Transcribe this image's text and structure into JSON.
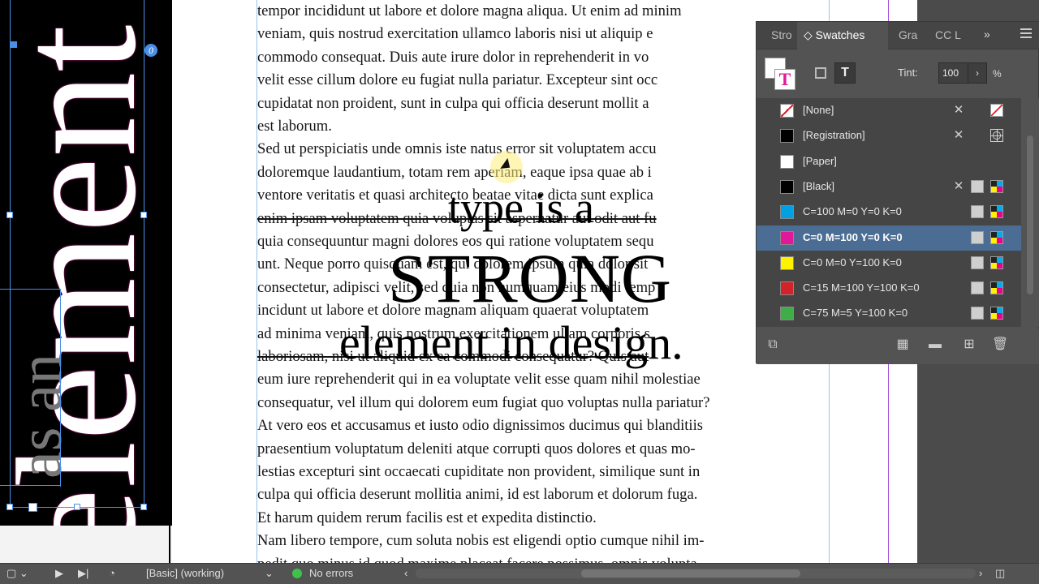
{
  "document": {
    "vertical_big_text": "element",
    "vertical_small_text": "as an",
    "body_lines": [
      "tempor incididunt ut labore et dolore magna aliqua. Ut enim ad minim",
      "veniam, quis nostrud exercitation ullamco laboris nisi ut aliquip e",
      "commodo consequat. Duis aute irure dolor in reprehenderit in vo",
      "velit esse cillum dolore eu fugiat nulla pariatur. Excepteur sint occ",
      "cupidatat non proident, sunt in culpa qui officia deserunt mollit a",
      "est laborum.",
      "Sed ut perspiciatis unde omnis iste natus error sit voluptatem accu",
      "doloremque laudantium, totam rem aperiam, eaque ipsa quae ab i",
      "ventore veritatis et quasi architecto beatae vitae dicta sunt explica",
      "enim ipsam voluptatem quia voluptas sit aspernatur aut odit aut fu",
      "quia consequuntur magni dolores eos qui ratione voluptatem sequ",
      "unt. Neque porro quisquam est, qui dolorem ipsum quia dolor sit",
      "consectetur, adipisci velit, sed quia non numquam eius modi temp",
      "incidunt ut labore et dolore magnam aliquam quaerat voluptatem",
      "ad minima veniam, quis nostrum exercitationem ullam corporis s",
      "laboriosam, nisi ut aliquid ex ea commodi consequatur? Quis aut",
      "eum iure reprehenderit qui in ea voluptate velit esse quam nihil molestiae",
      "consequatur, vel illum qui dolorem eum fugiat quo voluptas nulla pariatur?",
      "At vero eos et accusamus et iusto odio dignissimos ducimus qui blanditiis",
      "praesentium voluptatum deleniti atque corrupti quos dolores et quas mo-",
      "lestias excepturi sint occaecati cupiditate non provident, similique sunt in",
      "culpa qui officia deserunt mollitia animi, id est laborum et dolorum fuga.",
      "Et harum quidem rerum facilis est et expedita distinctio.",
      "Nam libero tempore, cum soluta nobis est eligendi optio cumque nihil im-",
      "pedit quo minus id quod maxime placeat facere possimus, omnis volupta"
    ],
    "display_line_1": "type is a",
    "display_line_2": "STRONG",
    "display_line_3": "element in design."
  },
  "swatches_panel": {
    "tabs": [
      "Stro",
      "Swatches",
      "Gra",
      "CC L"
    ],
    "expand_label": "»",
    "fill_glyph": "T",
    "formatting_text_glyph": "T",
    "tint_label": "Tint:",
    "tint_value": "100",
    "tint_arrow": "›",
    "tint_unit": "%",
    "swatches": [
      {
        "name": "[None]",
        "color": "none",
        "lock": true,
        "type": "none"
      },
      {
        "name": "[Registration]",
        "color": "#000000",
        "lock": true,
        "type": "registration"
      },
      {
        "name": "[Paper]",
        "color": "#ffffff",
        "lock": false,
        "type": "paper"
      },
      {
        "name": "[Black]",
        "color": "#000000",
        "lock": true,
        "type": "cmyk"
      },
      {
        "name": "C=100 M=0 Y=0 K=0",
        "color": "#00a0e3",
        "lock": false,
        "type": "cmyk"
      },
      {
        "name": "C=0 M=100 Y=0 K=0",
        "color": "#e0199b",
        "lock": false,
        "type": "cmyk",
        "selected": true
      },
      {
        "name": "C=0 M=0 Y=100 K=0",
        "color": "#fff200",
        "lock": false,
        "type": "cmyk"
      },
      {
        "name": "C=15 M=100 Y=100 K=0",
        "color": "#d2232a",
        "lock": false,
        "type": "cmyk"
      },
      {
        "name": "C=75 M=5 Y=100 K=0",
        "color": "#3fae49",
        "lock": false,
        "type": "cmyk"
      }
    ]
  },
  "status_bar": {
    "preflight_profile": "[Basic] (working)",
    "error_status": "No errors"
  },
  "colors": {
    "accent_magenta": "#e0199b",
    "frame_blue": "#4a8fe6",
    "selection_row": "#4b6d93",
    "status_ok": "#3ec24a"
  }
}
